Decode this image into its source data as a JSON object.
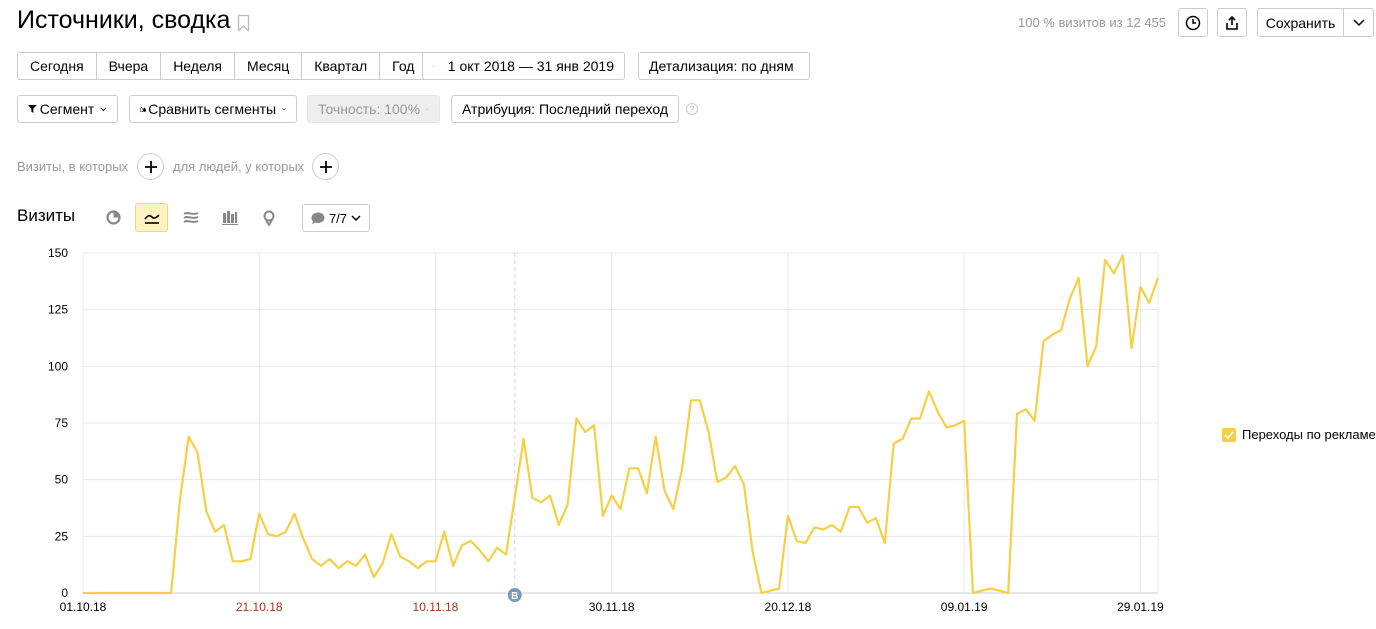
{
  "header": {
    "title": "Источники, сводка",
    "visits_info": "100 % визитов из 12 455",
    "save_label": "Сохранить"
  },
  "periods": [
    "Сегодня",
    "Вчера",
    "Неделя",
    "Месяц",
    "Квартал",
    "Год"
  ],
  "date_range": "1 окт 2018 — 31 янв 2019",
  "detail": "Детализация: по дням",
  "segment": "Сегмент",
  "compare_segments": "Сравнить сегменты",
  "accuracy": "Точность: 100%",
  "attribution": "Атрибуция: Последний переход",
  "help": "?",
  "conditions": {
    "visits_label": "Визиты, в которых",
    "people_label": "для людей, у которых"
  },
  "chart_section": {
    "title": "Визиты",
    "notes_label": "7/7"
  },
  "colors": {
    "series": "#f6cf45",
    "weekend_label": "#a33a1e",
    "grid": "#e8e8e8"
  },
  "chart_data": {
    "type": "line",
    "ylim": [
      0,
      150
    ],
    "yticks": [
      "0",
      "25",
      "50",
      "75",
      "100",
      "125",
      "150"
    ],
    "xticks": [
      {
        "label": "01.10.18",
        "day": 0,
        "weekend": false
      },
      {
        "label": "21.10.18",
        "day": 20,
        "weekend": true
      },
      {
        "label": "10.11.18",
        "day": 40,
        "weekend": true
      },
      {
        "label": "30.11.18",
        "day": 60,
        "weekend": false
      },
      {
        "label": "20.12.18",
        "day": 80,
        "weekend": false
      },
      {
        "label": "09.01.19",
        "day": 100,
        "weekend": false
      },
      {
        "label": "29.01.19",
        "day": 120,
        "weekend": false
      }
    ],
    "annotation": {
      "label": "B",
      "day": 49
    },
    "series": [
      {
        "name": "Переходы по рекламе",
        "values": [
          0,
          0,
          0,
          0,
          0,
          0,
          0,
          0,
          0,
          0,
          0,
          41,
          69,
          62,
          36,
          27,
          30,
          14,
          14,
          15,
          35,
          26,
          25,
          27,
          35,
          24,
          15,
          12,
          15,
          11,
          14,
          12,
          17,
          7,
          13,
          26,
          16,
          14,
          11,
          14,
          14,
          27,
          12,
          21,
          23,
          19,
          14,
          20,
          17,
          42,
          68,
          42,
          40,
          43,
          30,
          39,
          77,
          71,
          74,
          34,
          43,
          37,
          55,
          55,
          44,
          69,
          45,
          37,
          55,
          85,
          85,
          71,
          49,
          51,
          56,
          48,
          18,
          0,
          1,
          2,
          34,
          23,
          22,
          29,
          28,
          30,
          27,
          38,
          38,
          31,
          33,
          22,
          66,
          68,
          77,
          77,
          89,
          80,
          73,
          74,
          76,
          0,
          1,
          2,
          1,
          0,
          79,
          81,
          76,
          111,
          114,
          116,
          130,
          139,
          100,
          109,
          147,
          141,
          149,
          108,
          135,
          128,
          139
        ]
      }
    ]
  }
}
